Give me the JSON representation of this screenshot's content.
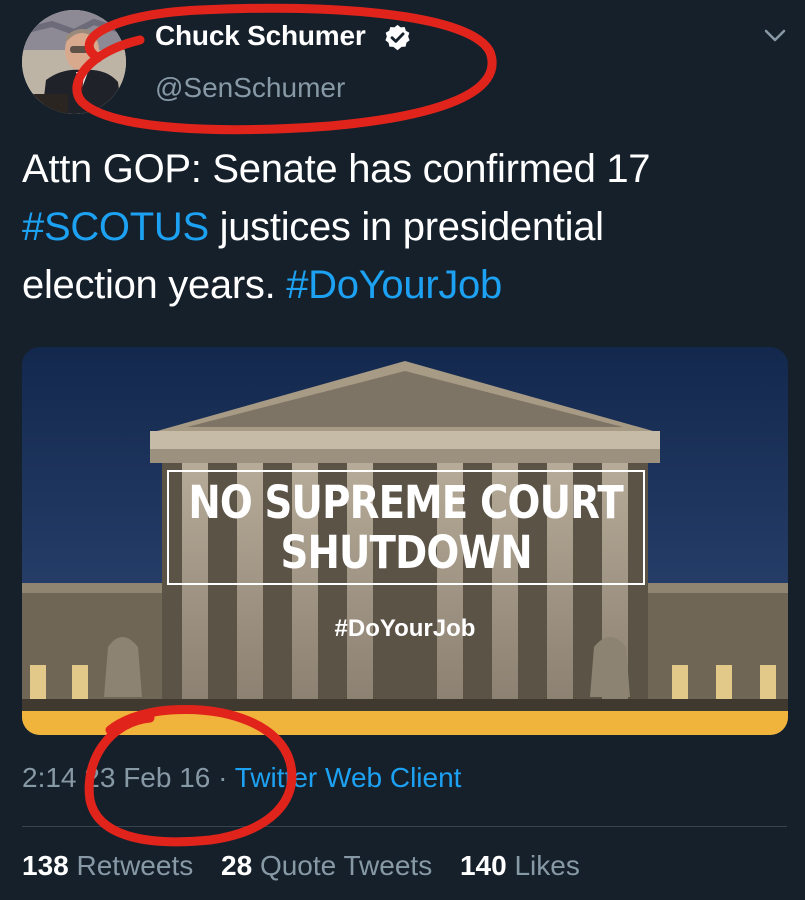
{
  "tweet": {
    "author_name": "Chuck Schumer",
    "handle": "@SenSchumer",
    "text_part1": "Attn GOP: Senate has confirmed 17",
    "hashtag_scotus": "#SCOTUS",
    "text_part2": " justices in presidential",
    "text_part3": "election years. ",
    "hashtag_doyourjob": "#DoYourJob"
  },
  "card": {
    "headline_line1": "NO SUPREME COURT",
    "headline_line2": "SHUTDOWN",
    "tag": "#DoYourJob"
  },
  "meta": {
    "time": "2:14",
    "date": "23 Feb 16",
    "separator": "·",
    "client": "Twitter Web Client"
  },
  "stats": {
    "retweets_count": "138",
    "retweets_label": "Retweets",
    "quotes_count": "28",
    "quotes_label": "Quote Tweets",
    "likes_count": "140",
    "likes_label": "Likes"
  },
  "colors": {
    "background": "#15202b",
    "link": "#1da1f2",
    "muted": "#8899a6",
    "annotation": "#e0241b"
  },
  "icons": [
    "verified-badge-icon",
    "chevron-down-icon"
  ]
}
